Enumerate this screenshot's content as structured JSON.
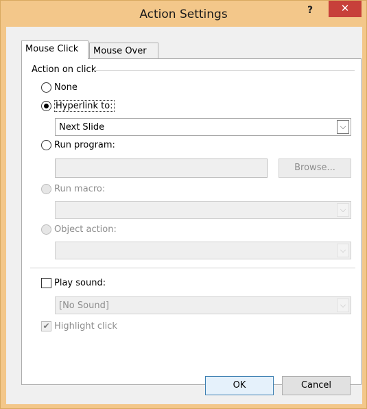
{
  "window": {
    "title": "Action Settings",
    "help_glyph": "?",
    "close_glyph": "✕"
  },
  "tabs": [
    {
      "label": "Mouse Click",
      "active": true
    },
    {
      "label": "Mouse Over",
      "active": false
    }
  ],
  "action_group": {
    "label": "Action on click",
    "options": {
      "none": {
        "label": "None",
        "checked": false,
        "disabled": false
      },
      "hyperlink": {
        "label": "Hyperlink to:",
        "checked": true,
        "disabled": false
      },
      "run_program": {
        "label": "Run program:",
        "checked": false,
        "disabled": false
      },
      "run_macro": {
        "label": "Run macro:",
        "checked": false,
        "disabled": true
      },
      "object_action": {
        "label": "Object action:",
        "checked": false,
        "disabled": true
      }
    },
    "hyperlink_select": {
      "value": "Next Slide"
    },
    "run_program_input": {
      "value": ""
    },
    "browse_button": {
      "label": "Browse..."
    },
    "run_macro_select": {
      "value": ""
    },
    "object_action_select": {
      "value": ""
    }
  },
  "sound": {
    "play_sound_label": "Play sound:",
    "play_sound_checked": false,
    "sound_select": {
      "value": "[No Sound]"
    },
    "highlight_label": "Highlight click",
    "highlight_checked": true,
    "check_glyph": "✔"
  },
  "footer": {
    "ok_label": "OK",
    "cancel_label": "Cancel"
  },
  "icons": {
    "dropdown_arrow": "chevron-down-icon",
    "dropdown_glyph": "⌵"
  }
}
